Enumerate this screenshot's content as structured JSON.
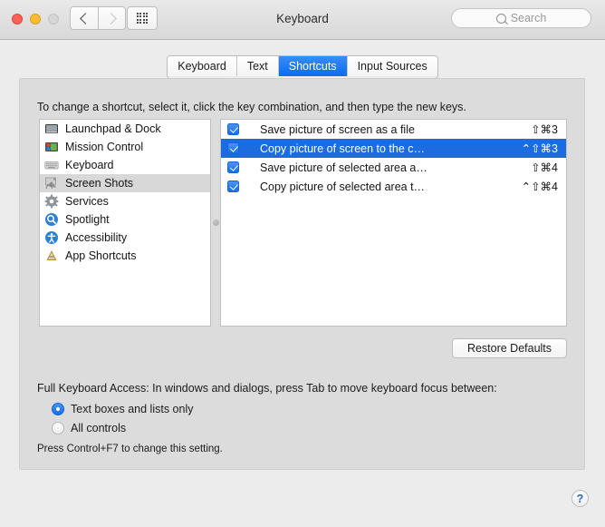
{
  "window": {
    "title": "Keyboard",
    "traffic_lights": [
      "close",
      "minimize",
      "zoom"
    ],
    "nav_back": "back-chevron",
    "nav_forward": "forward-chevron",
    "show_all": "grid-icon"
  },
  "search": {
    "placeholder": "Search",
    "value": "",
    "icon": "search-icon"
  },
  "tabs": [
    {
      "label": "Keyboard",
      "active": false
    },
    {
      "label": "Text",
      "active": false
    },
    {
      "label": "Shortcuts",
      "active": true
    },
    {
      "label": "Input Sources",
      "active": false
    }
  ],
  "instruction": "To change a shortcut, select it, click the key combination, and then type the new keys.",
  "categories": [
    {
      "label": "Launchpad & Dock",
      "icon": "launchpad-dock-icon",
      "selected": false
    },
    {
      "label": "Mission Control",
      "icon": "mission-control-icon",
      "selected": false
    },
    {
      "label": "Keyboard",
      "icon": "keyboard-icon",
      "selected": false
    },
    {
      "label": "Screen Shots",
      "icon": "screen-shots-icon",
      "selected": true
    },
    {
      "label": "Services",
      "icon": "services-gear-icon",
      "selected": false
    },
    {
      "label": "Spotlight",
      "icon": "spotlight-icon",
      "selected": false
    },
    {
      "label": "Accessibility",
      "icon": "accessibility-icon",
      "selected": false
    },
    {
      "label": "App Shortcuts",
      "icon": "app-shortcuts-icon",
      "selected": false
    }
  ],
  "shortcuts": [
    {
      "checked": true,
      "name": "Save picture of screen as a file",
      "keys": "⇧⌘3",
      "selected": false
    },
    {
      "checked": true,
      "name": "Copy picture of screen to the c…",
      "keys": "⌃⇧⌘3",
      "selected": true
    },
    {
      "checked": true,
      "name": "Save picture of selected area a…",
      "keys": "⇧⌘4",
      "selected": false
    },
    {
      "checked": true,
      "name": "Copy picture of selected area t…",
      "keys": "⌃⇧⌘4",
      "selected": false
    }
  ],
  "restore_defaults_label": "Restore Defaults",
  "full_keyboard_access": {
    "title": "Full Keyboard Access: In windows and dialogs, press Tab to move keyboard focus between:",
    "options": [
      {
        "label": "Text boxes and lists only",
        "selected": true
      },
      {
        "label": "All controls",
        "selected": false
      }
    ],
    "hint": "Press Control+F7 to change this setting."
  },
  "help_label": "?",
  "colors": {
    "accent_blue": "#176fe8",
    "selection_blue": "#1a6ce0",
    "sidebar_selection": "#d8d8d8",
    "panel_bg": "#dcdcdc",
    "window_bg": "#ececec"
  }
}
